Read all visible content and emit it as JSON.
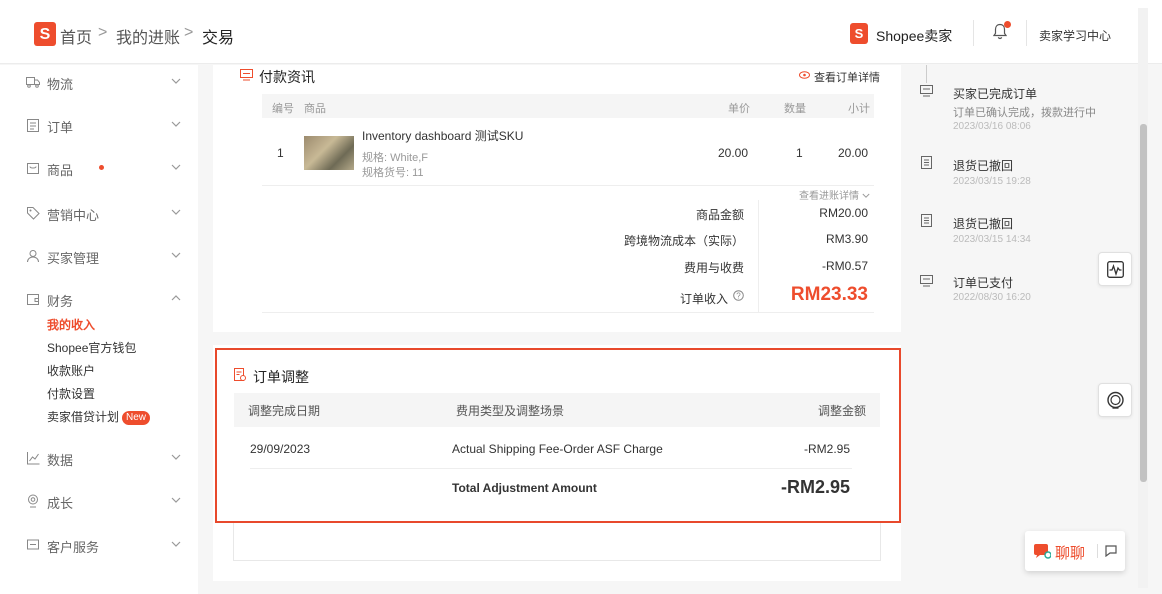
{
  "header": {
    "logo_letter": "S",
    "breadcrumb": [
      "首页",
      "我的进账",
      "交易"
    ],
    "sep": ">",
    "brand": "Shopee卖家",
    "learning_center": "卖家学习中心"
  },
  "sidebar": {
    "items": [
      {
        "label": "物流",
        "icon": "truck-icon"
      },
      {
        "label": "订单",
        "icon": "clipboard-icon"
      },
      {
        "label": "商品",
        "icon": "shop-icon"
      },
      {
        "label": "营销中心",
        "icon": "tag-icon"
      },
      {
        "label": "买家管理",
        "icon": "user-icon"
      },
      {
        "label": "财务",
        "icon": "wallet-icon"
      },
      {
        "label": "数据",
        "icon": "chart-icon"
      },
      {
        "label": "成长",
        "icon": "badge-icon"
      },
      {
        "label": "客户服务",
        "icon": "chat-icon"
      }
    ],
    "finance_sub": [
      "我的收入",
      "Shopee官方钱包",
      "收款账户",
      "付款设置",
      "卖家借贷计划"
    ],
    "new_badge": "New"
  },
  "payment": {
    "title": "付款资讯",
    "view_details": "查看订单详情",
    "columns": [
      "编号",
      "商品",
      "单价",
      "数量",
      "小计"
    ],
    "row": {
      "no": "1",
      "name": "Inventory dashboard 测试SKU",
      "spec": "规格: White,F",
      "sku": "规格货号: 11",
      "price": "20.00",
      "qty": "1",
      "subtotal": "20.00"
    },
    "view_income": "查看进账详情",
    "summary": [
      {
        "label": "商品金额",
        "value": "RM20.00"
      },
      {
        "label": "跨境物流成本（实际）",
        "value": "RM3.90"
      },
      {
        "label": "费用与收费",
        "value": "-RM0.57"
      }
    ],
    "income_label": "订单收入",
    "income_value": "RM23.33"
  },
  "adjustment": {
    "title": "订单调整",
    "columns": [
      "调整完成日期",
      "费用类型及调整场景",
      "调整金额"
    ],
    "rows": [
      {
        "date": "29/09/2023",
        "type": "Actual Shipping Fee-Order ASF Charge",
        "amount": "-RM2.95"
      }
    ],
    "total_label": "Total Adjustment Amount",
    "total_value": "-RM2.95"
  },
  "timeline": [
    {
      "title": "买家已完成订单",
      "sub": "订单已确认完成，拨款进行中",
      "date": "2023/03/16 08:06"
    },
    {
      "title": "退货已撤回",
      "sub": "",
      "date": "2023/03/15 19:28"
    },
    {
      "title": "退货已撤回",
      "sub": "",
      "date": "2023/03/15 14:34"
    },
    {
      "title": "订单已支付",
      "sub": "",
      "date": "2022/08/30 16:20"
    }
  ],
  "chat": {
    "label": "聊聊"
  },
  "colors": {
    "brand": "#ee4d2d",
    "highlight_border": "#e8492c"
  }
}
